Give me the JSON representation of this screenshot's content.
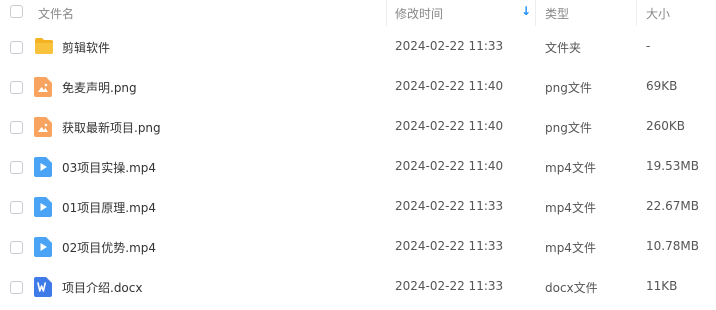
{
  "header": {
    "name_label": "文件名",
    "modified_label": "修改时间",
    "sort_indicator": "↓",
    "type_label": "类型",
    "size_label": "大小"
  },
  "files": [
    {
      "name": "剪辑软件",
      "modified": "2024-02-22 11:33",
      "type": "文件夹",
      "size": "-",
      "icon": "folder-icon"
    },
    {
      "name": "免麦声明.png",
      "modified": "2024-02-22 11:40",
      "type": "png文件",
      "size": "69KB",
      "icon": "image-file-icon"
    },
    {
      "name": "获取最新项目.png",
      "modified": "2024-02-22 11:40",
      "type": "png文件",
      "size": "260KB",
      "icon": "image-file-icon"
    },
    {
      "name": "03项目实操.mp4",
      "modified": "2024-02-22 11:40",
      "type": "mp4文件",
      "size": "19.53MB",
      "icon": "video-file-icon"
    },
    {
      "name": "01项目原理.mp4",
      "modified": "2024-02-22 11:33",
      "type": "mp4文件",
      "size": "22.67MB",
      "icon": "video-file-icon"
    },
    {
      "name": "02项目优势.mp4",
      "modified": "2024-02-22 11:33",
      "type": "mp4文件",
      "size": "10.78MB",
      "icon": "video-file-icon"
    },
    {
      "name": "项目介绍.docx",
      "modified": "2024-02-22 11:33",
      "type": "docx文件",
      "size": "11KB",
      "icon": "word-file-icon"
    }
  ],
  "colors": {
    "folder": "#f9c23c",
    "image": "#f8a35f",
    "video": "#4aa3f5",
    "word": "#3f7be8",
    "sort_indicator": "#1e90ff"
  }
}
